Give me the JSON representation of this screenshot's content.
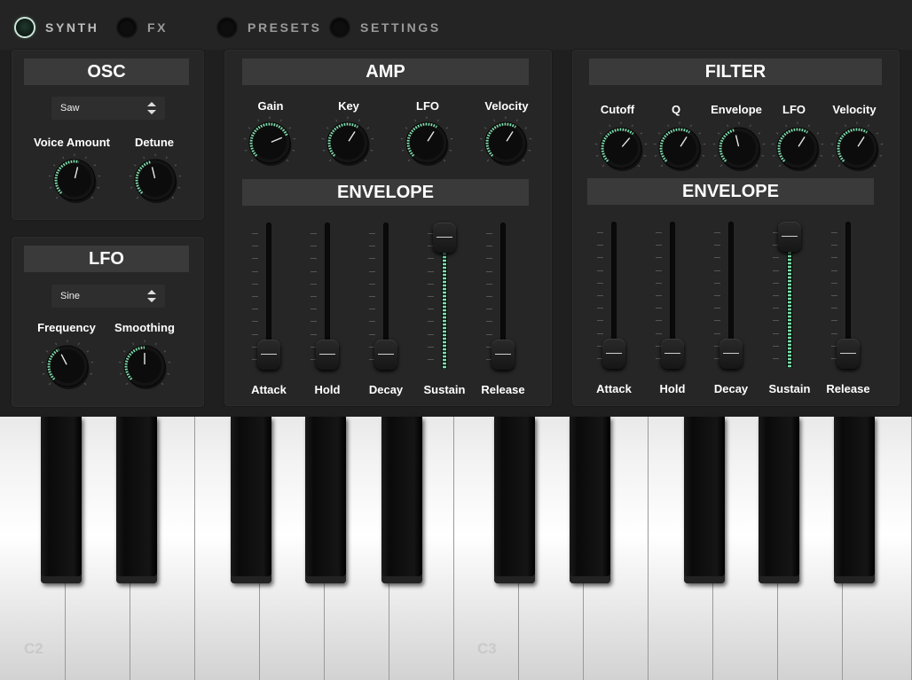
{
  "nav": {
    "tabs": [
      {
        "label": "SYNTH",
        "active": true
      },
      {
        "label": "FX",
        "active": false
      },
      {
        "label": "PRESETS",
        "active": false
      },
      {
        "label": "SETTINGS",
        "active": false
      }
    ]
  },
  "osc": {
    "title": "OSC",
    "waveform": "Saw",
    "knobs": [
      {
        "label": "Voice Amount",
        "value": 0.55
      },
      {
        "label": "Detune",
        "value": 0.45
      }
    ]
  },
  "lfo": {
    "title": "LFO",
    "waveform": "Sine",
    "knobs": [
      {
        "label": "Frequency",
        "value": 0.4
      },
      {
        "label": "Smoothing",
        "value": 0.5
      }
    ]
  },
  "amp": {
    "title": "AMP",
    "knobs": [
      {
        "label": "Gain",
        "value": 0.75
      },
      {
        "label": "Key",
        "value": 0.62
      },
      {
        "label": "LFO",
        "value": 0.62
      },
      {
        "label": "Velocity",
        "value": 0.62
      }
    ],
    "envelope": {
      "title": "ENVELOPE",
      "sliders": [
        {
          "label": "Attack",
          "value": 0.0
        },
        {
          "label": "Hold",
          "value": 0.0
        },
        {
          "label": "Decay",
          "value": 0.0
        },
        {
          "label": "Sustain",
          "value": 1.0
        },
        {
          "label": "Release",
          "value": 0.0
        }
      ]
    }
  },
  "filter": {
    "title": "FILTER",
    "knobs": [
      {
        "label": "Cutoff",
        "value": 0.65
      },
      {
        "label": "Q",
        "value": 0.62
      },
      {
        "label": "Envelope",
        "value": 0.45
      },
      {
        "label": "LFO",
        "value": 0.62
      },
      {
        "label": "Velocity",
        "value": 0.62
      }
    ],
    "envelope": {
      "title": "ENVELOPE",
      "sliders": [
        {
          "label": "Attack",
          "value": 0.0
        },
        {
          "label": "Hold",
          "value": 0.0
        },
        {
          "label": "Decay",
          "value": 0.0
        },
        {
          "label": "Sustain",
          "value": 1.0
        },
        {
          "label": "Release",
          "value": 0.0
        }
      ]
    }
  },
  "keyboard": {
    "note_labels": [
      "C2",
      "C3"
    ]
  },
  "colors": {
    "accent": "#7fe0ad",
    "panel": "#262626",
    "title_bar": "#3a3a3a"
  }
}
